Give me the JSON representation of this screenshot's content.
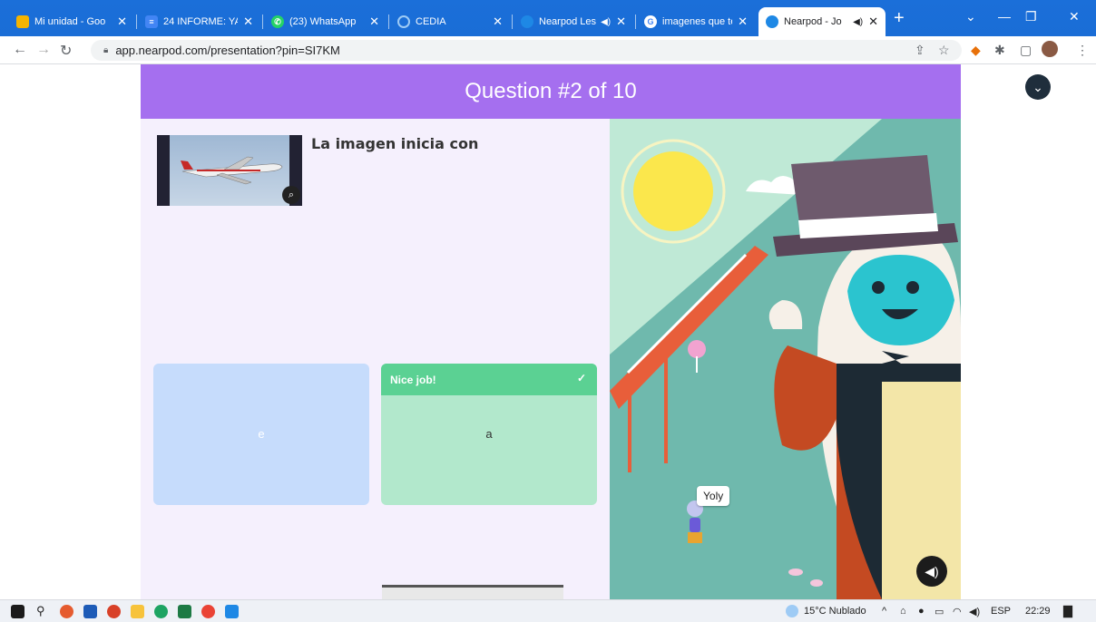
{
  "browser": {
    "tabs": [
      {
        "title": "Mi unidad - Goo",
        "favicon_color": "#f4b400",
        "active": false
      },
      {
        "title": "24 INFORME: YA",
        "favicon_color": "#4285f4",
        "active": false
      },
      {
        "title": "(23) WhatsApp",
        "favicon_color": "#25d366",
        "active": false
      },
      {
        "title": "CEDIA",
        "favicon_color": "#9ecbf5",
        "active": false
      },
      {
        "title": "Nearpod Les",
        "favicon_color": "#1e88e5",
        "active": false
      },
      {
        "title": "imagenes que te",
        "favicon_color": "#ffffff",
        "active": false
      },
      {
        "title": "Nearpod - Jo",
        "favicon_color": "#1e88e5",
        "active": true
      }
    ],
    "new_tab": "+",
    "window_controls": {
      "minimize": "—",
      "maximize": "❐",
      "close": "✕",
      "tab_list": "⌄"
    },
    "url": "app.nearpod.com/presentation?pin=SI7KM"
  },
  "page": {
    "header_title": "Question #2 of 10",
    "question_text": "La imagen inicia con",
    "answers": [
      {
        "text": "e",
        "status": ""
      },
      {
        "text": "a",
        "status": "Nice job!"
      }
    ],
    "player_name": "Yoly"
  },
  "taskbar": {
    "weather": "15°C  Nublado",
    "language": "ESP",
    "time": "22:29"
  },
  "colors": {
    "header": "#a56fef",
    "panel": "#f5f0fd",
    "answer_blue": "#c6dcfc",
    "answer_green": "#b2e8cc",
    "correct_bar": "#5bd193"
  }
}
